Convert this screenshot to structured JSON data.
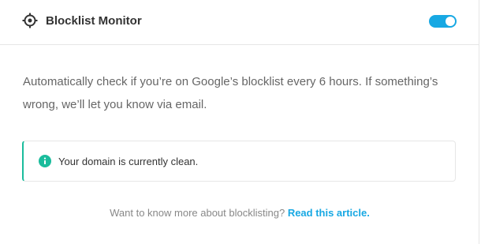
{
  "header": {
    "icon": "target-icon",
    "title": "Blocklist Monitor",
    "toggle_enabled": true
  },
  "description": "Automatically check if you’re on Google’s blocklist every 6 hours. If something’s wrong, we’ll let you know via email.",
  "notice": {
    "icon": "info-icon",
    "text": "Your domain is currently clean."
  },
  "footer": {
    "text": "Want to know more about blocklisting? ",
    "link_text": "Read this article."
  },
  "colors": {
    "accent": "#17a8e3",
    "success": "#1abc9c",
    "title_text": "#333333",
    "body_text": "#666666"
  }
}
